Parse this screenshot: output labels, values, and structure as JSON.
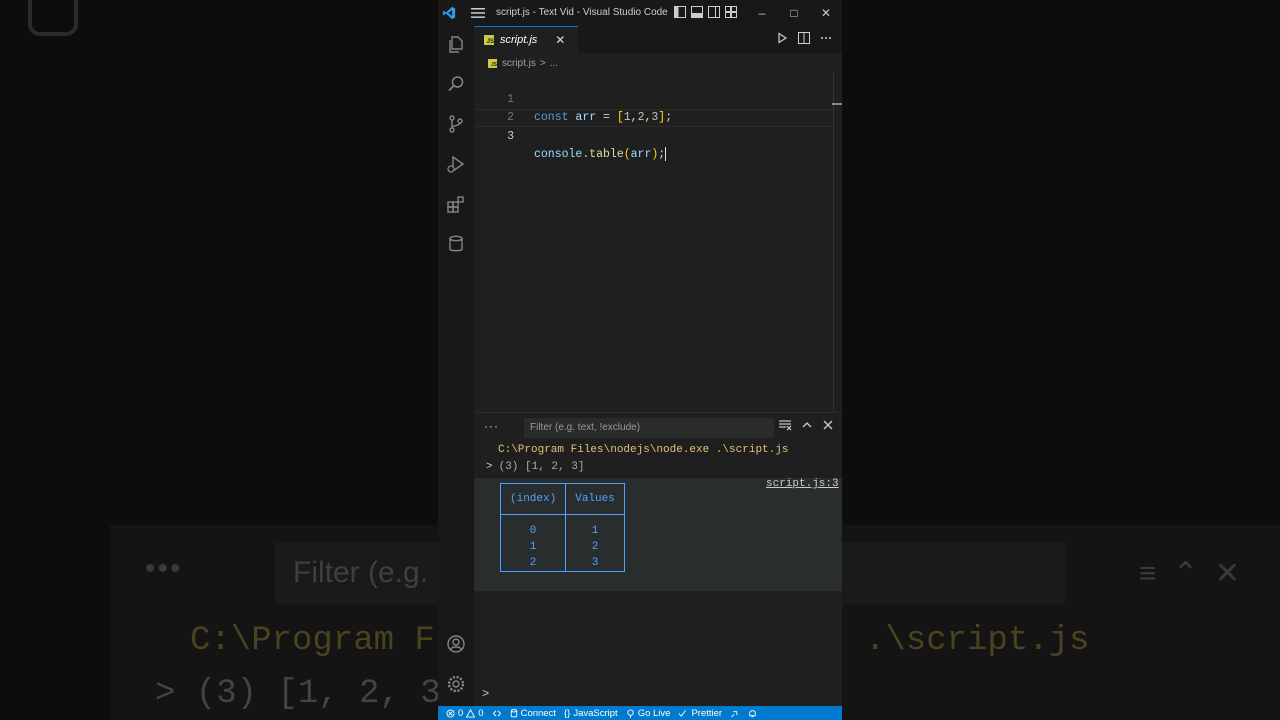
{
  "background": {
    "filter_placeholder": "Filter (e.g.",
    "dots": "•••",
    "path_left": "C:\\Program F",
    "path_right": ".\\script.js",
    "output": "> (3) [1, 2, 3"
  },
  "titlebar": {
    "title": "script.js - Text Vid - Visual Studio Code",
    "minimize": "–",
    "maximize": "□",
    "close": "✕"
  },
  "tab": {
    "label": "script.js",
    "close": "✕",
    "js_badge": "JS"
  },
  "breadcrumb": {
    "file": "script.js",
    "sep": ">",
    "rest": "..."
  },
  "editor": {
    "lines": [
      {
        "num": "1"
      },
      {
        "num": "2"
      },
      {
        "num": "3"
      }
    ],
    "line1": {
      "kw": "const",
      "var": "arr",
      "eq": " = ",
      "open": "[",
      "v1": "1",
      "c1": ",",
      "v2": "2",
      "c2": ",",
      "v3": "3",
      "close": "]",
      "semi": ";"
    },
    "line3": {
      "obj": "console",
      "dot": ".",
      "fn": "table",
      "open": "(",
      "arg": "arr",
      "close": ")",
      "semi": ";"
    }
  },
  "panel": {
    "dots": "···",
    "filter_placeholder": "Filter (e.g. text, !exclude)",
    "command": "C:\\Program Files\\nodejs\\node.exe .\\script.js",
    "output_chevron": ">",
    "output": "(3) [1, 2, 3]",
    "source_link": "script.js:3",
    "table": {
      "headers": [
        "(index)",
        "Values"
      ],
      "rows": [
        [
          "0",
          "1"
        ],
        [
          "1",
          "2"
        ],
        [
          "2",
          "3"
        ]
      ]
    },
    "prompt": ">"
  },
  "statusbar": {
    "errors": "0",
    "warnings": "0",
    "connect": "Connect",
    "language": "JavaScript",
    "golive": "Go Live",
    "prettier": "Prettier"
  },
  "colors": {
    "accent": "#007acc",
    "table_border": "#4fa3ff",
    "command_text": "#e5c07b"
  }
}
